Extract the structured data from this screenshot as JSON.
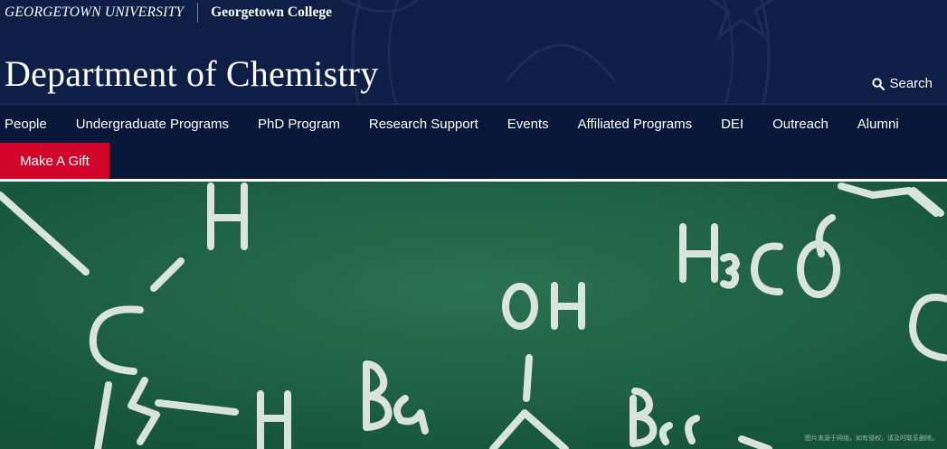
{
  "topbar": {
    "university": "GEORGETOWN UNIVERSITY",
    "college": "Georgetown College"
  },
  "header": {
    "title": "Department of Chemistry",
    "search_label": "Search"
  },
  "nav": {
    "items": [
      "People",
      "Undergraduate Programs",
      "PhD Program",
      "Research Support",
      "Events",
      "Affiliated Programs",
      "DEI",
      "Outreach",
      "Alumni"
    ],
    "gift_label": "Make A Gift"
  },
  "hero": {
    "caption": "图片来源于网络，如有侵权，请及时联系删除。"
  },
  "colors": {
    "navy": "#0d1f47",
    "gift_red": "#d1042a",
    "chalkboard_green": "#1d5f44"
  },
  "icons": [
    "search-icon",
    "seal-watermark"
  ]
}
